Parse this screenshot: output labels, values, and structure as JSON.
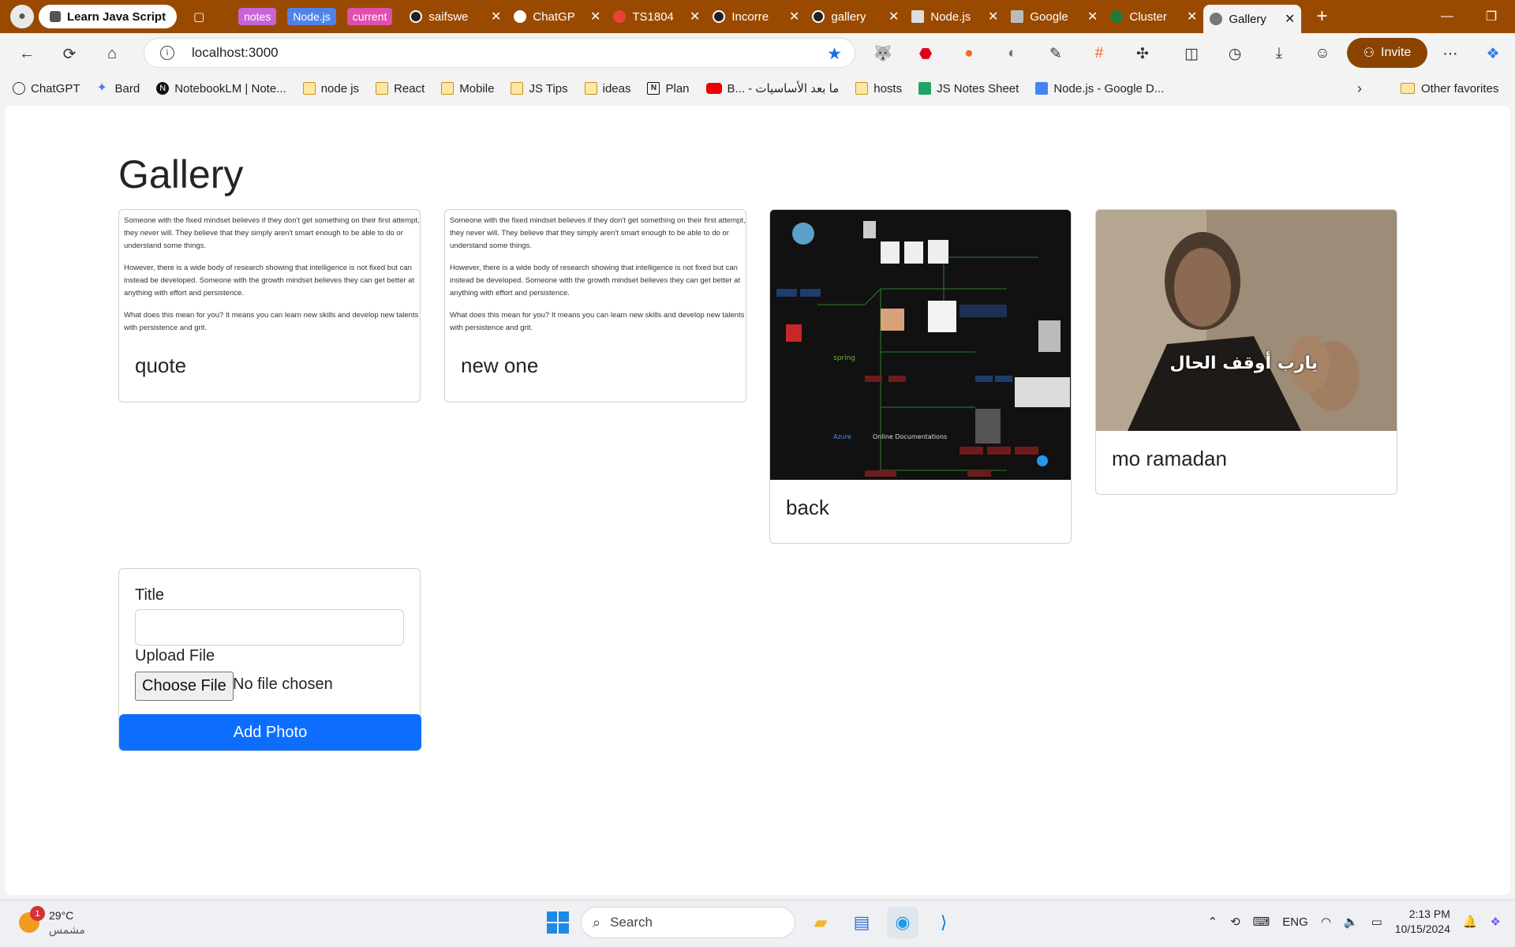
{
  "browser": {
    "tab_groups": [
      {
        "label": "notes",
        "color": "#c765d6"
      },
      {
        "label": "Node.js",
        "color": "#4f83e8"
      },
      {
        "label": "current",
        "color": "#e04fae"
      }
    ],
    "pinned_tab": "Learn Java Script",
    "tabs": [
      {
        "label": "saifswe"
      },
      {
        "label": "ChatGP"
      },
      {
        "label": "TS1804"
      },
      {
        "label": "Incorre"
      },
      {
        "label": "gallery"
      },
      {
        "label": "Node.js"
      },
      {
        "label": "Google"
      },
      {
        "label": "Cluster"
      }
    ],
    "active_tab": "Gallery",
    "url": "localhost:3000",
    "invite_label": "Invite",
    "bookmarks": [
      {
        "label": "ChatGPT",
        "icon": "chatgpt-icon"
      },
      {
        "label": "Bard",
        "icon": "bard-icon"
      },
      {
        "label": "NotebookLM | Note...",
        "icon": "notion-icon"
      },
      {
        "label": "node js",
        "icon": "folder-icon"
      },
      {
        "label": "React",
        "icon": "folder-icon"
      },
      {
        "label": "Mobile",
        "icon": "folder-icon"
      },
      {
        "label": "JS Tips",
        "icon": "folder-icon"
      },
      {
        "label": "ideas",
        "icon": "folder-icon"
      },
      {
        "label": "Plan",
        "icon": "notion-icon"
      },
      {
        "label": "B... - ما بعد الأساسيات",
        "icon": "youtube-icon"
      },
      {
        "label": "hosts",
        "icon": "folder-icon"
      },
      {
        "label": "JS Notes Sheet",
        "icon": "sheets-icon"
      },
      {
        "label": "Node.js - Google D...",
        "icon": "docs-icon"
      }
    ],
    "other_favorites": "Other favorites"
  },
  "page": {
    "title": "Gallery",
    "quote_paragraphs": [
      "Someone with the fixed mindset believes if they don't get something on their first attempt, they never will. They believe that they simply aren't smart enough to be able to do or understand some things.",
      "However, there is a wide body of research showing that intelligence is not fixed but can instead be developed. Someone with the growth mindset believes they can get better at anything with effort and persistence.",
      "What does this mean for you? It means you can learn new skills and develop new talents with persistence and grit."
    ],
    "cards": [
      {
        "title": "quote"
      },
      {
        "title": "new one"
      },
      {
        "title": "back"
      },
      {
        "title": "mo ramadan"
      }
    ],
    "meme_caption": "يارب أوقف الحال",
    "form": {
      "title_label": "Title",
      "title_value": "",
      "upload_label": "Upload File",
      "choose_file": "Choose File",
      "file_status": "No file chosen",
      "submit": "Add Photo"
    }
  },
  "taskbar": {
    "weather_temp": "29°C",
    "weather_desc": "مشمس",
    "notification_count": "1",
    "search_placeholder": "Search",
    "language": "ENG",
    "time": "2:13 PM",
    "date": "10/15/2024"
  },
  "colors": {
    "accent_tabstrip": "#9a4a00",
    "primary_button": "#0d6efd"
  }
}
